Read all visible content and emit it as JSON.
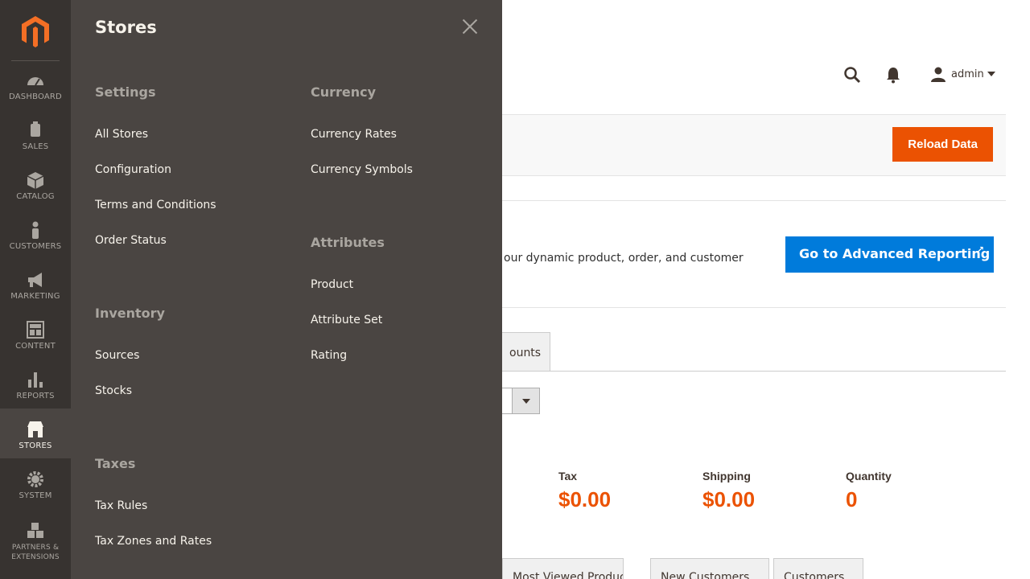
{
  "nav": {
    "items": [
      {
        "label": "Dashboard",
        "icon": "dashboard-icon"
      },
      {
        "label": "Sales",
        "icon": "dollar-icon"
      },
      {
        "label": "Catalog",
        "icon": "box-icon"
      },
      {
        "label": "Customers",
        "icon": "person-icon"
      },
      {
        "label": "Marketing",
        "icon": "megaphone-icon"
      },
      {
        "label": "Content",
        "icon": "layout-icon"
      },
      {
        "label": "Reports",
        "icon": "bar-chart-icon"
      },
      {
        "label": "Stores",
        "icon": "storefront-icon"
      },
      {
        "label": "System",
        "icon": "gear-icon"
      },
      {
        "label": "Partners & Extensions",
        "icon": "cubes-icon"
      }
    ]
  },
  "header": {
    "user_name": "admin"
  },
  "action_bar": {
    "reload_label": "Reload Data"
  },
  "advanced": {
    "text": "our dynamic product, order, and customer",
    "button_label": "Go to Advanced Reporting"
  },
  "tabs_top": {
    "partial_label": "ounts"
  },
  "totals": [
    {
      "label": "Tax",
      "value": "$0.00"
    },
    {
      "label": "Shipping",
      "value": "$0.00"
    },
    {
      "label": "Quantity",
      "value": "0"
    }
  ],
  "tabs_bottom": [
    {
      "label": "Most Viewed Products"
    },
    {
      "label": "New Customers"
    },
    {
      "label": "Customers"
    }
  ],
  "stores_panel": {
    "title": "Stores",
    "groups": {
      "settings": {
        "title": "Settings",
        "links": [
          "All Stores",
          "Configuration",
          "Terms and Conditions",
          "Order Status"
        ]
      },
      "inventory": {
        "title": "Inventory",
        "links": [
          "Sources",
          "Stocks"
        ]
      },
      "taxes": {
        "title": "Taxes",
        "links": [
          "Tax Rules",
          "Tax Zones and Rates"
        ]
      },
      "currency": {
        "title": "Currency",
        "links": [
          "Currency Rates",
          "Currency Symbols"
        ]
      },
      "attributes": {
        "title": "Attributes",
        "links": [
          "Product",
          "Attribute Set",
          "Rating"
        ]
      }
    }
  },
  "colors": {
    "nav_bg": "#373330",
    "panel_bg": "#4a4542",
    "accent_orange": "#eb5202",
    "accent_blue": "#007bdb"
  }
}
